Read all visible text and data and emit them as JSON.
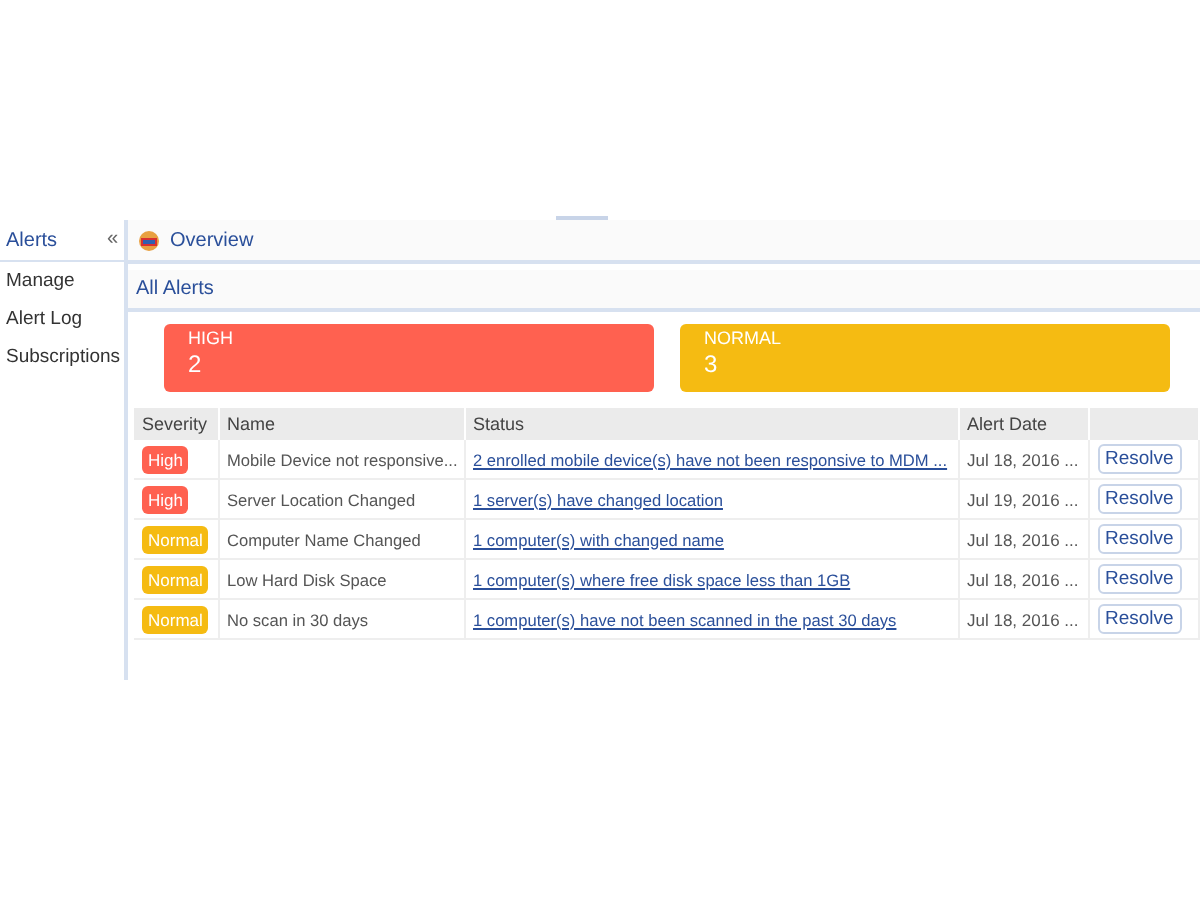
{
  "sidebar": {
    "title": "Alerts",
    "collapse_icon": "«",
    "items": [
      {
        "label": "Manage"
      },
      {
        "label": "Alert Log"
      },
      {
        "label": "Subscriptions"
      }
    ]
  },
  "header": {
    "title": "Overview"
  },
  "section": {
    "title": "All Alerts"
  },
  "summary": [
    {
      "label": "HIGH",
      "count": "2",
      "kind": "high"
    },
    {
      "label": "NORMAL",
      "count": "3",
      "kind": "normal"
    }
  ],
  "table": {
    "columns": [
      "Severity",
      "Name",
      "Status",
      "Alert Date"
    ],
    "rows": [
      {
        "severity": "High",
        "kind": "high",
        "name": "Mobile Device not responsive...",
        "status": "2 enrolled mobile device(s) have not been responsive to MDM ...",
        "date": "Jul 18, 2016 ...",
        "action": "Resolve"
      },
      {
        "severity": "High",
        "kind": "high",
        "name": "Server Location Changed",
        "status": "1 server(s) have changed location",
        "date": "Jul 19, 2016 ...",
        "action": "Resolve"
      },
      {
        "severity": "Normal",
        "kind": "normal",
        "name": "Computer Name Changed",
        "status": "1 computer(s) with changed name",
        "date": "Jul 18, 2016 ...",
        "action": "Resolve"
      },
      {
        "severity": "Normal",
        "kind": "normal",
        "name": "Low Hard Disk Space",
        "status": "1 computer(s) where free disk space less than 1GB",
        "date": "Jul 18, 2016 ...",
        "action": "Resolve"
      },
      {
        "severity": "Normal",
        "kind": "normal",
        "name": "No scan in 30 days",
        "status": "1 computer(s) have not been scanned in the past 30 days",
        "date": "Jul 18, 2016 ...",
        "action": "Resolve"
      }
    ]
  }
}
